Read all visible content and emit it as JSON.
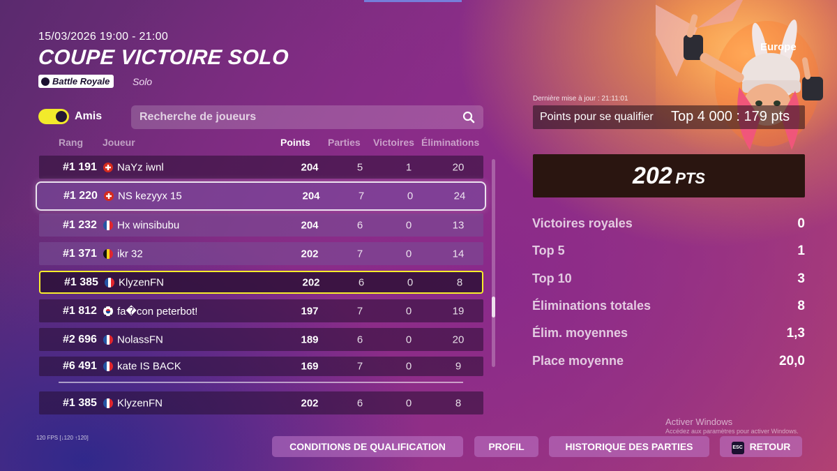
{
  "event": {
    "datetime": "15/03/2026 19:00 - 21:00",
    "title": "COUPE VICTOIRE SOLO",
    "badge": "Battle Royale",
    "mode": "Solo"
  },
  "filters": {
    "toggle_label": "Amis",
    "toggle_on": true,
    "search_placeholder": "Recherche de joueurs"
  },
  "table": {
    "headers": {
      "rank": "Rang",
      "player": "Joueur",
      "points": "Points",
      "games": "Parties",
      "wins": "Victoires",
      "elims": "Éliminations"
    },
    "rows": [
      {
        "rank": "#1 191",
        "flag": "switzerland",
        "name": "NaYz iwnl",
        "points": "204",
        "games": "5",
        "wins": "1",
        "elims": "20"
      },
      {
        "rank": "#1 220",
        "flag": "switzerland",
        "name": "NS kezyyx 15",
        "points": "204",
        "games": "7",
        "wins": "0",
        "elims": "24"
      },
      {
        "rank": "#1 232",
        "flag": "france",
        "name": "Hx winsibubu",
        "points": "204",
        "games": "6",
        "wins": "0",
        "elims": "13"
      },
      {
        "rank": "#1 371",
        "flag": "belgium",
        "name": "ikr 32",
        "points": "202",
        "games": "7",
        "wins": "0",
        "elims": "14"
      },
      {
        "rank": "#1 385",
        "flag": "france",
        "name": "KlyzenFN",
        "points": "202",
        "games": "6",
        "wins": "0",
        "elims": "8"
      },
      {
        "rank": "#1 812",
        "flag": "south-korea",
        "name": "fa�con peterbot!",
        "points": "197",
        "games": "7",
        "wins": "0",
        "elims": "19"
      },
      {
        "rank": "#2 696",
        "flag": "france",
        "name": "NolassFN",
        "points": "189",
        "games": "6",
        "wins": "0",
        "elims": "20"
      },
      {
        "rank": "#6 491",
        "flag": "france",
        "name": "kate IS BACK",
        "points": "169",
        "games": "7",
        "wins": "0",
        "elims": "9"
      }
    ],
    "self_row": {
      "rank": "#1 385",
      "flag": "france",
      "name": "KlyzenFN",
      "points": "202",
      "games": "6",
      "wins": "0",
      "elims": "8"
    }
  },
  "summary": {
    "region": "Europe",
    "last_update": "Dernière mise à jour : 21:11:01",
    "qualify_label": "Points pour se qualifier",
    "qualify_value": "Top 4 000 : 179 pts",
    "total_points": "202",
    "total_unit": "PTS",
    "stats": [
      {
        "label": "Victoires royales",
        "value": "0"
      },
      {
        "label": "Top 5",
        "value": "1"
      },
      {
        "label": "Top 10",
        "value": "3"
      },
      {
        "label": "Éliminations totales",
        "value": "8"
      },
      {
        "label": "Élim. moyennes",
        "value": "1,3"
      },
      {
        "label": "Place moyenne",
        "value": "20,0"
      }
    ]
  },
  "footer": {
    "fps": "120 FPS [↓120 ↑120]",
    "activate_title": "Activer Windows",
    "activate_sub": "Accédez aux paramètres pour activer Windows.",
    "buttons": {
      "conditions": "CONDITIONS DE QUALIFICATION",
      "profile": "PROFIL",
      "history": "HISTORIQUE DES PARTIES",
      "esc_key": "ESC",
      "back": "RETOUR"
    }
  },
  "colors": {
    "selected_outline": "#f7ee2b",
    "toggle_on": "#f2ea2b"
  }
}
